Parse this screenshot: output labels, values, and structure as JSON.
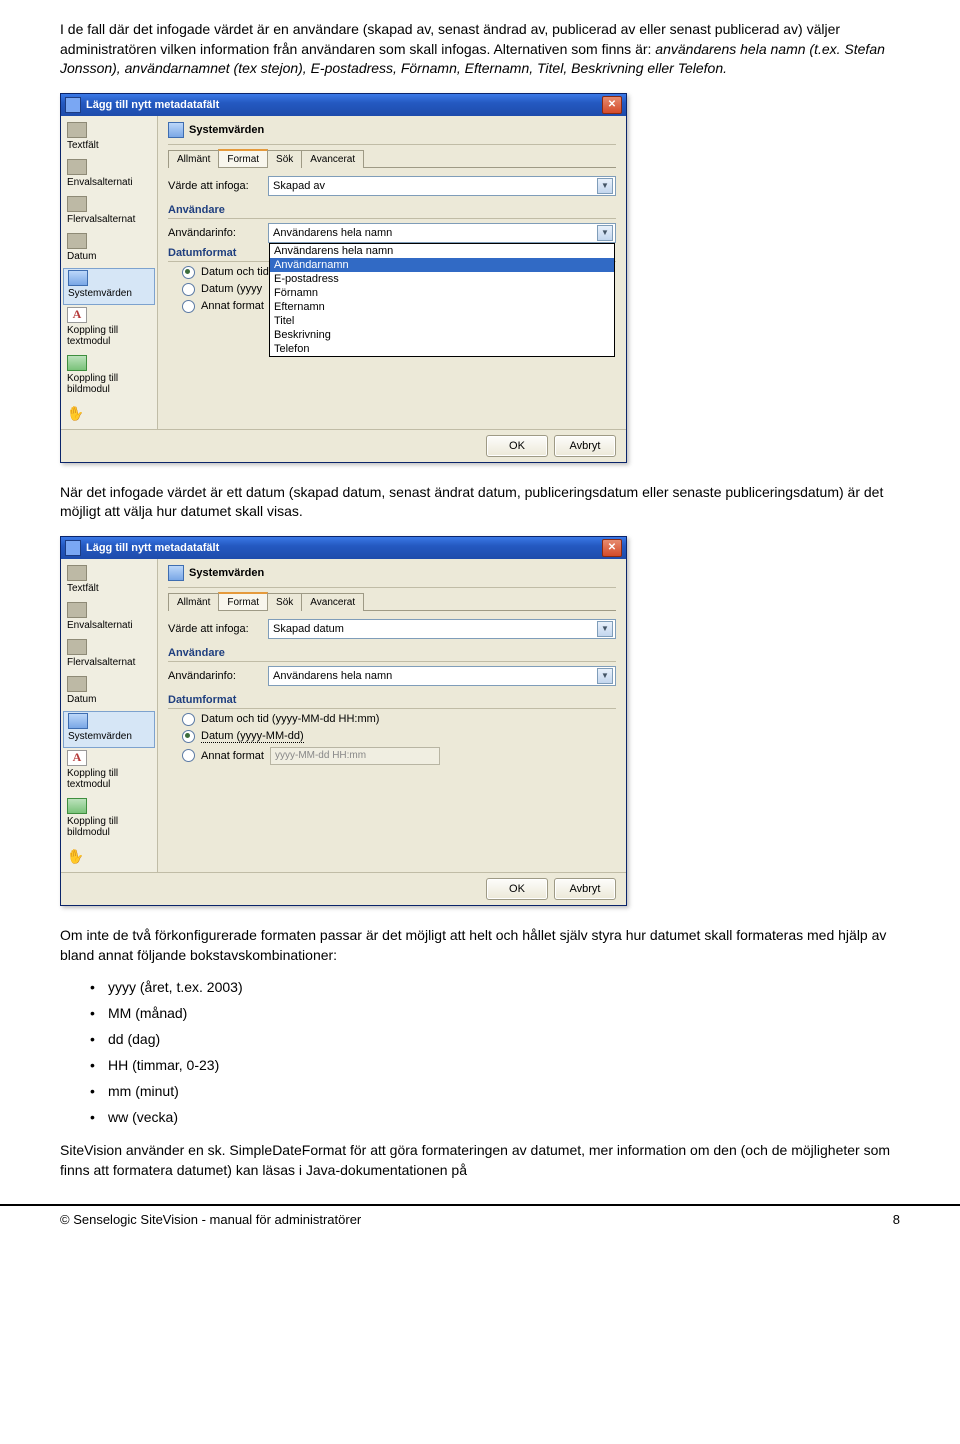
{
  "text": {
    "para1": "I de fall där det infogade värdet är en användare (skapad av, senast ändrad av, publicerad av eller senast publicerad av) väljer administratören vilken information från användaren som skall infogas. Alternativen som finns är: ",
    "para1b": "användarens hela namn (t.ex. Stefan Jonsson), användarnamnet (tex stejon), E-postadress, Förnamn, Efternamn, Titel, Beskrivning eller Telefon.",
    "para2": "När det infogade värdet är ett datum (skapad datum, senast ändrat datum, publiceringsdatum eller senaste publiceringsdatum) är det möjligt att välja hur datumet skall visas.",
    "para3": "Om inte de två förkonfigurerade formaten passar är det möjligt att helt och hållet själv styra hur datumet skall formateras med hjälp av bland annat följande bokstavskombinationer:",
    "bullets": [
      "yyyy (året, t.ex. 2003)",
      "MM (månad)",
      "dd (dag)",
      "HH (timmar, 0-23)",
      "mm (minut)",
      "ww (vecka)"
    ],
    "para4": "SiteVision använder en sk. SimpleDateFormat för att göra formateringen av datumet, mer information om den (och de möjligheter som finns att formatera datumet) kan läsas i Java-dokumentationen på"
  },
  "footer": {
    "left": "© Senselogic SiteVision - manual för administratörer",
    "right": "8"
  },
  "dialog": {
    "title": "Lägg till nytt metadatafält",
    "panelTitle": "Systemvärden",
    "sidebar": [
      "Textfält",
      "Envalsalternati",
      "Flervalsalternat",
      "Datum",
      "Systemvärden",
      "Koppling till textmodul",
      "Koppling till bildmodul"
    ],
    "tabs": [
      "Allmänt",
      "Format",
      "Sök",
      "Avancerat"
    ],
    "labels": {
      "valueToInsert": "Värde att infoga:",
      "userSection": "Användare",
      "userInfo": "Användarinfo:",
      "dateSection": "Datumformat",
      "radio1": "Datum och tid",
      "radio1full": "Datum och tid (yyyy-MM-dd HH:mm)",
      "radio2short": "Datum (yyyy",
      "radio2dotted": "Datum (yyyy-MM-dd)",
      "radio3": "Annat format",
      "placeholderDate": "yyyy-MM-dd HH:mm",
      "ok": "OK",
      "cancel": "Avbryt"
    },
    "d1": {
      "valueSelected": "Skapad av",
      "userInfoSelected": "Användarens hela namn",
      "options": [
        "Användarens hela namn",
        "Användarnamn",
        "E-postadress",
        "Förnamn",
        "Efternamn",
        "Titel",
        "Beskrivning",
        "Telefon"
      ]
    },
    "d2": {
      "valueSelected": "Skapad datum",
      "userInfoSelected": "Användarens hela namn"
    }
  }
}
